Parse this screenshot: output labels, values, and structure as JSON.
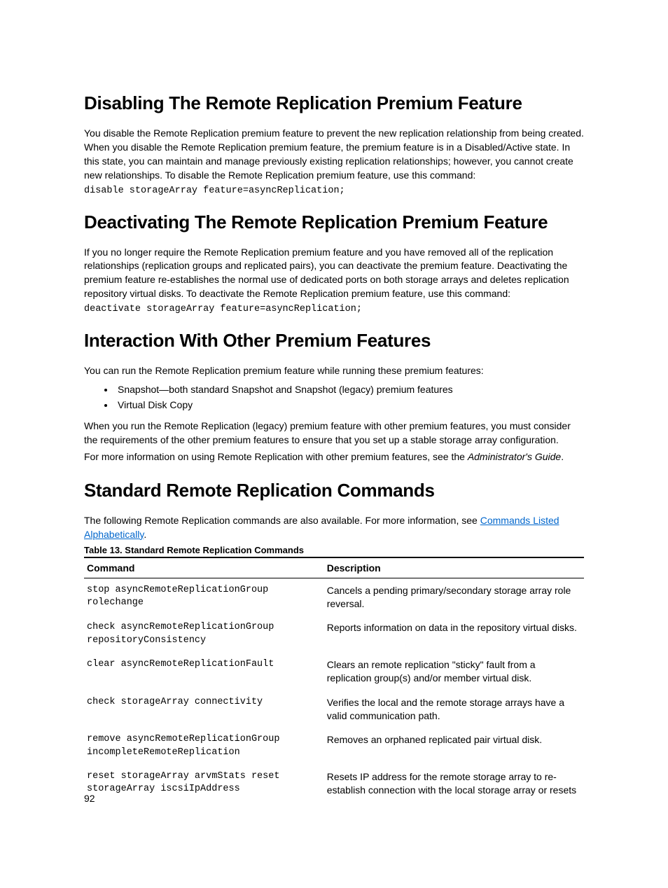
{
  "pageNumber": "92",
  "section1": {
    "heading": "Disabling The Remote Replication Premium Feature",
    "para1": "You disable the Remote Replication premium feature to prevent the new replication relationship from being created. When you disable the Remote Replication premium feature, the premium feature is in a Disabled/Active state. In this state, you can maintain and manage previously existing replication relationships; however, you cannot create new relationships. To disable the Remote Replication premium feature, use this command:",
    "code1": "disable storageArray feature=asyncReplication;"
  },
  "section2": {
    "heading": "Deactivating The Remote Replication Premium Feature",
    "para1": "If you no longer require the Remote Replication premium feature and you have removed all of the replication relationships (replication groups and replicated pairs), you can deactivate the premium feature. Deactivating the premium feature re-establishes the normal use of dedicated ports on both storage arrays and deletes replication repository virtual disks. To deactivate the Remote Replication premium feature, use this command:",
    "code1": "deactivate storageArray feature=asyncReplication;"
  },
  "section3": {
    "heading": "Interaction With Other Premium Features",
    "intro": "You can run the Remote Replication premium feature while running these premium features:",
    "bullets": [
      "Snapshot—both standard Snapshot and Snapshot (legacy) premium features",
      "Virtual Disk Copy"
    ],
    "para2": "When you run the Remote Replication (legacy) premium feature with other premium features, you must consider the requirements of the other premium features to ensure that you set up a stable storage array configuration.",
    "para3_pre": "For more information on using Remote Replication with other premium features, see the ",
    "para3_italic": "Administrator's Guide",
    "para3_post": "."
  },
  "section4": {
    "heading": "Standard Remote Replication Commands",
    "intro_pre": "The following Remote Replication commands are also available. For more information, see ",
    "intro_link": "Commands Listed Alphabetically",
    "intro_post": ".",
    "table_caption": "Table 13. Standard Remote Replication Commands",
    "headers": {
      "command": "Command",
      "description": "Description"
    },
    "rows": [
      {
        "cmd": "stop asyncRemoteReplicationGroup\nrolechange",
        "desc": "Cancels a pending primary/secondary storage array role reversal."
      },
      {
        "cmd": "check asyncRemoteReplicationGroup\nrepositoryConsistency",
        "desc": "Reports information on data in the repository virtual disks."
      },
      {
        "cmd": "clear asyncRemoteReplicationFault",
        "desc": "Clears an remote replication \"sticky\" fault from a replication group(s) and/or member virtual disk."
      },
      {
        "cmd": "check storageArray connectivity",
        "desc": "Verifies the local and the remote storage arrays have a valid communication path."
      },
      {
        "cmd": "remove asyncRemoteReplicationGroup\nincompleteRemoteReplication",
        "desc": "Removes an orphaned replicated pair virtual disk."
      },
      {
        "cmd": "reset storageArray arvmStats reset\nstorageArray iscsiIpAddress",
        "desc": "Resets IP address for the remote storage array to re-establish connection with the local storage array or resets"
      }
    ]
  }
}
